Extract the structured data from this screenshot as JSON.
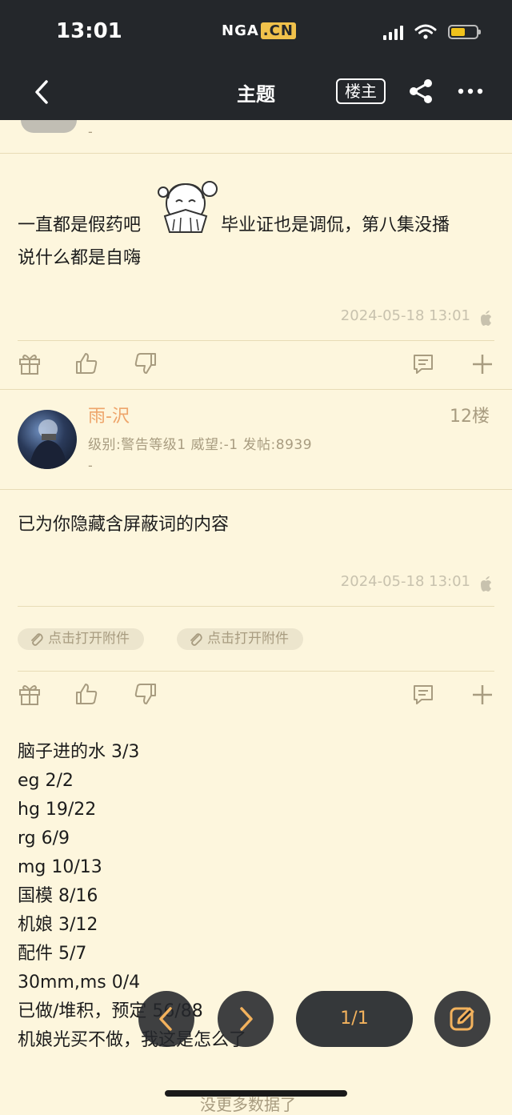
{
  "status_bar": {
    "time": "13:01",
    "logo": "NGA",
    "logo_suffix": ".CN",
    "battery_level": 0.55
  },
  "nav": {
    "title": "主题",
    "op_label": "楼主"
  },
  "post_prev": {
    "dash": "-",
    "text_before": "一直都是假药吧",
    "text_after": "毕业证也是调侃，第八集没播",
    "text_line2": "说什么都是自嗨",
    "time": "2024-05-18 13:01"
  },
  "post_12": {
    "username": "雨-沢",
    "floor": "12楼",
    "meta": "级别:警告等级1  威望:-1  发帖:8939",
    "dash": "-",
    "text": "已为你隐藏含屏蔽词的内容",
    "time": "2024-05-18 13:01",
    "attachments": [
      "点击打开附件",
      "点击打开附件"
    ]
  },
  "list_lines": [
    "脑子进的水 3/3",
    "eg 2/2",
    "hg 19/22",
    "rg 6/9",
    "mg 10/13",
    "国模 8/16",
    "机娘 3/12",
    "配件 5/7",
    "30mm,ms 0/4",
    "已做/堆积，预定 56/88",
    "机娘光买不做，我这是怎么了"
  ],
  "pager": {
    "label": "1/1"
  },
  "footer": {
    "more": "没更多数据了"
  },
  "icons": [
    "back-icon",
    "share-icon",
    "more-icon",
    "gift-icon",
    "like-icon",
    "dislike-icon",
    "comment-icon",
    "plus-icon",
    "apple-icon",
    "paperclip-icon",
    "prev-icon",
    "next-icon",
    "edit-icon"
  ],
  "colors": {
    "background": "#fdf6dd",
    "bar": "#24272b",
    "username": "#eea56b",
    "accent": "#f3b25d"
  }
}
